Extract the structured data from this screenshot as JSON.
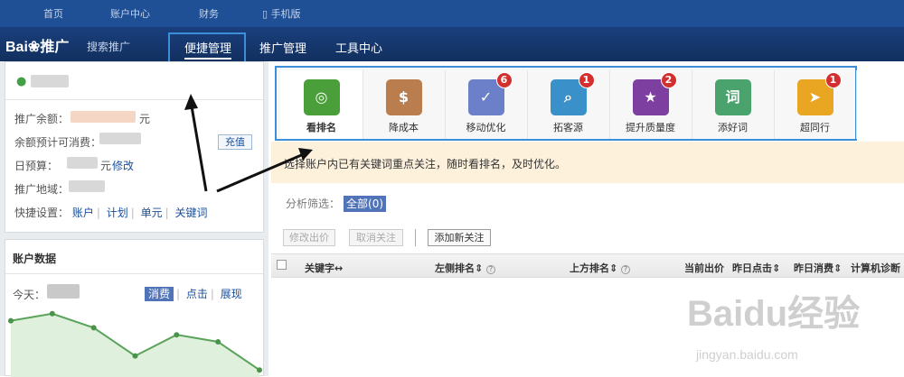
{
  "topbar": {
    "items": [
      "首页",
      "账户中心",
      "财务",
      "手机版"
    ]
  },
  "navbar": {
    "logo": "Bai",
    "logo_paw": "du",
    "logo_suffix": "推广",
    "subtitle": "搜索推广",
    "tabs": [
      "便捷管理",
      "推广管理",
      "工具中心"
    ]
  },
  "account": {
    "balance_label": "推广余额：",
    "balance_unit": "元",
    "days_label": "余额预计可消费：",
    "recharge": "充值",
    "budget_label": "日预算：",
    "budget_unit": "元",
    "budget_edit": "修改",
    "region_label": "推广地域：",
    "shortcuts_label": "快捷设置：",
    "shortcuts": [
      "账户",
      "计划",
      "单元",
      "关键词"
    ]
  },
  "data_panel": {
    "title": "账户数据",
    "today_label": "今天：",
    "tabs": [
      "消费",
      "点击",
      "展现"
    ]
  },
  "chart_data": {
    "type": "area",
    "series": [
      {
        "values": [
          6,
          7,
          5,
          1,
          4,
          3,
          -1
        ]
      }
    ]
  },
  "tools": [
    {
      "label": "看排名",
      "icon": "target-icon",
      "color": "#4a9f3a",
      "badge": ""
    },
    {
      "label": "降成本",
      "icon": "piggy-bank-icon",
      "color": "#b97d4e",
      "badge": ""
    },
    {
      "label": "移动优化",
      "icon": "mobile-check-icon",
      "color": "#6b80c9",
      "badge": "6"
    },
    {
      "label": "拓客源",
      "icon": "magnifier-icon",
      "color": "#3a91c9",
      "badge": "1"
    },
    {
      "label": "提升质量度",
      "icon": "stars-icon",
      "color": "#7d3fa0",
      "badge": "2"
    },
    {
      "label": "添好词",
      "icon": "word-card-icon",
      "color": "#4aa36c",
      "badge": ""
    },
    {
      "label": "超同行",
      "icon": "runner-icon",
      "color": "#e8a623",
      "badge": "1"
    }
  ],
  "notice": "选择账户内已有关键词重点关注，随时看排名，及时优化。",
  "filter": {
    "label": "分析筛选：",
    "all": "全部(0)"
  },
  "actions": {
    "modify_bid": "修改出价",
    "cancel_follow": "取消关注",
    "add_follow": "添加新关注"
  },
  "table": {
    "headers": [
      "关键字",
      "左侧排名",
      "上方排名",
      "当前出价",
      "昨日点击",
      "昨日消费",
      "计算机诊断"
    ]
  },
  "watermark": {
    "main": "Baidu经验",
    "url": "jingyan.baidu.com"
  }
}
